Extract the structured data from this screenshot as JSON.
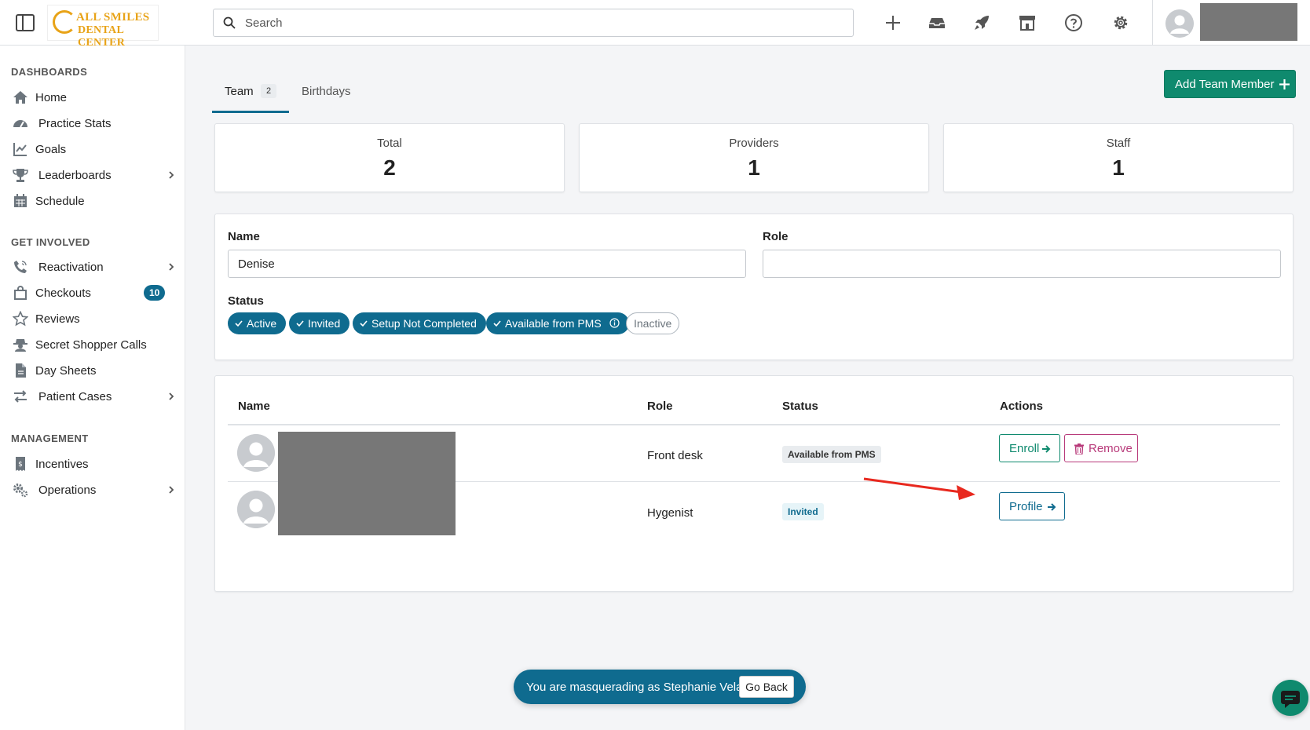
{
  "app": {
    "logo_line1": "ALL SMILES",
    "logo_line2": "DENTAL CENTER",
    "brand_color": "#e8a317",
    "accent": "#0f6b8f",
    "success": "#0f8a6e"
  },
  "topbar": {
    "search_placeholder": "Search",
    "icons": [
      "plus-icon",
      "inbox-icon",
      "rocket-icon",
      "store-icon",
      "help-icon",
      "gear-icon"
    ]
  },
  "sidebar": {
    "sections": [
      {
        "title": "DASHBOARDS",
        "items": [
          {
            "label": "Home",
            "icon": "home-icon"
          },
          {
            "label": "Practice Stats",
            "icon": "gauge-icon"
          },
          {
            "label": "Goals",
            "icon": "chart-line-icon"
          },
          {
            "label": "Leaderboards",
            "icon": "trophy-icon",
            "chevron": true
          },
          {
            "label": "Schedule",
            "icon": "calendar-icon"
          }
        ]
      },
      {
        "title": "GET INVOLVED",
        "items": [
          {
            "label": "Reactivation",
            "icon": "phone-icon",
            "chevron": true
          },
          {
            "label": "Checkouts",
            "icon": "shopping-bag-icon",
            "badge": "10"
          },
          {
            "label": "Reviews",
            "icon": "star-icon"
          },
          {
            "label": "Secret Shopper Calls",
            "icon": "user-secret-icon"
          },
          {
            "label": "Day Sheets",
            "icon": "file-icon"
          },
          {
            "label": "Patient Cases",
            "icon": "exchange-icon",
            "chevron": true
          }
        ]
      },
      {
        "title": "MANAGEMENT",
        "items": [
          {
            "label": "Incentives",
            "icon": "receipt-icon"
          },
          {
            "label": "Operations",
            "icon": "gears-icon",
            "chevron": true
          }
        ]
      }
    ]
  },
  "tabs": {
    "team_label": "Team",
    "team_count": "2",
    "birthdays_label": "Birthdays"
  },
  "add_button_label": "Add Team Member",
  "stats": [
    {
      "label": "Total",
      "value": "2"
    },
    {
      "label": "Providers",
      "value": "1"
    },
    {
      "label": "Staff",
      "value": "1"
    }
  ],
  "filters": {
    "name_label": "Name",
    "name_value": "Denise",
    "role_label": "Role",
    "role_value": "",
    "status_label": "Status",
    "chips": [
      {
        "label": "Active",
        "selected": true
      },
      {
        "label": "Invited",
        "selected": true
      },
      {
        "label": "Setup Not Completed",
        "selected": true
      },
      {
        "label": "Available from PMS",
        "selected": true,
        "info": true
      },
      {
        "label": "Inactive",
        "selected": false
      }
    ]
  },
  "table": {
    "headers": {
      "name": "Name",
      "role": "Role",
      "status": "Status",
      "actions": "Actions"
    },
    "rows": [
      {
        "role": "Front desk",
        "status": "Available from PMS",
        "actions": [
          "Enroll",
          "Remove"
        ]
      },
      {
        "role": "Hygenist",
        "status": "Invited",
        "actions": [
          "Profile"
        ]
      }
    ]
  },
  "masquerade": {
    "text": "You are masquerading as Stephanie Vela",
    "button": "Go Back"
  }
}
